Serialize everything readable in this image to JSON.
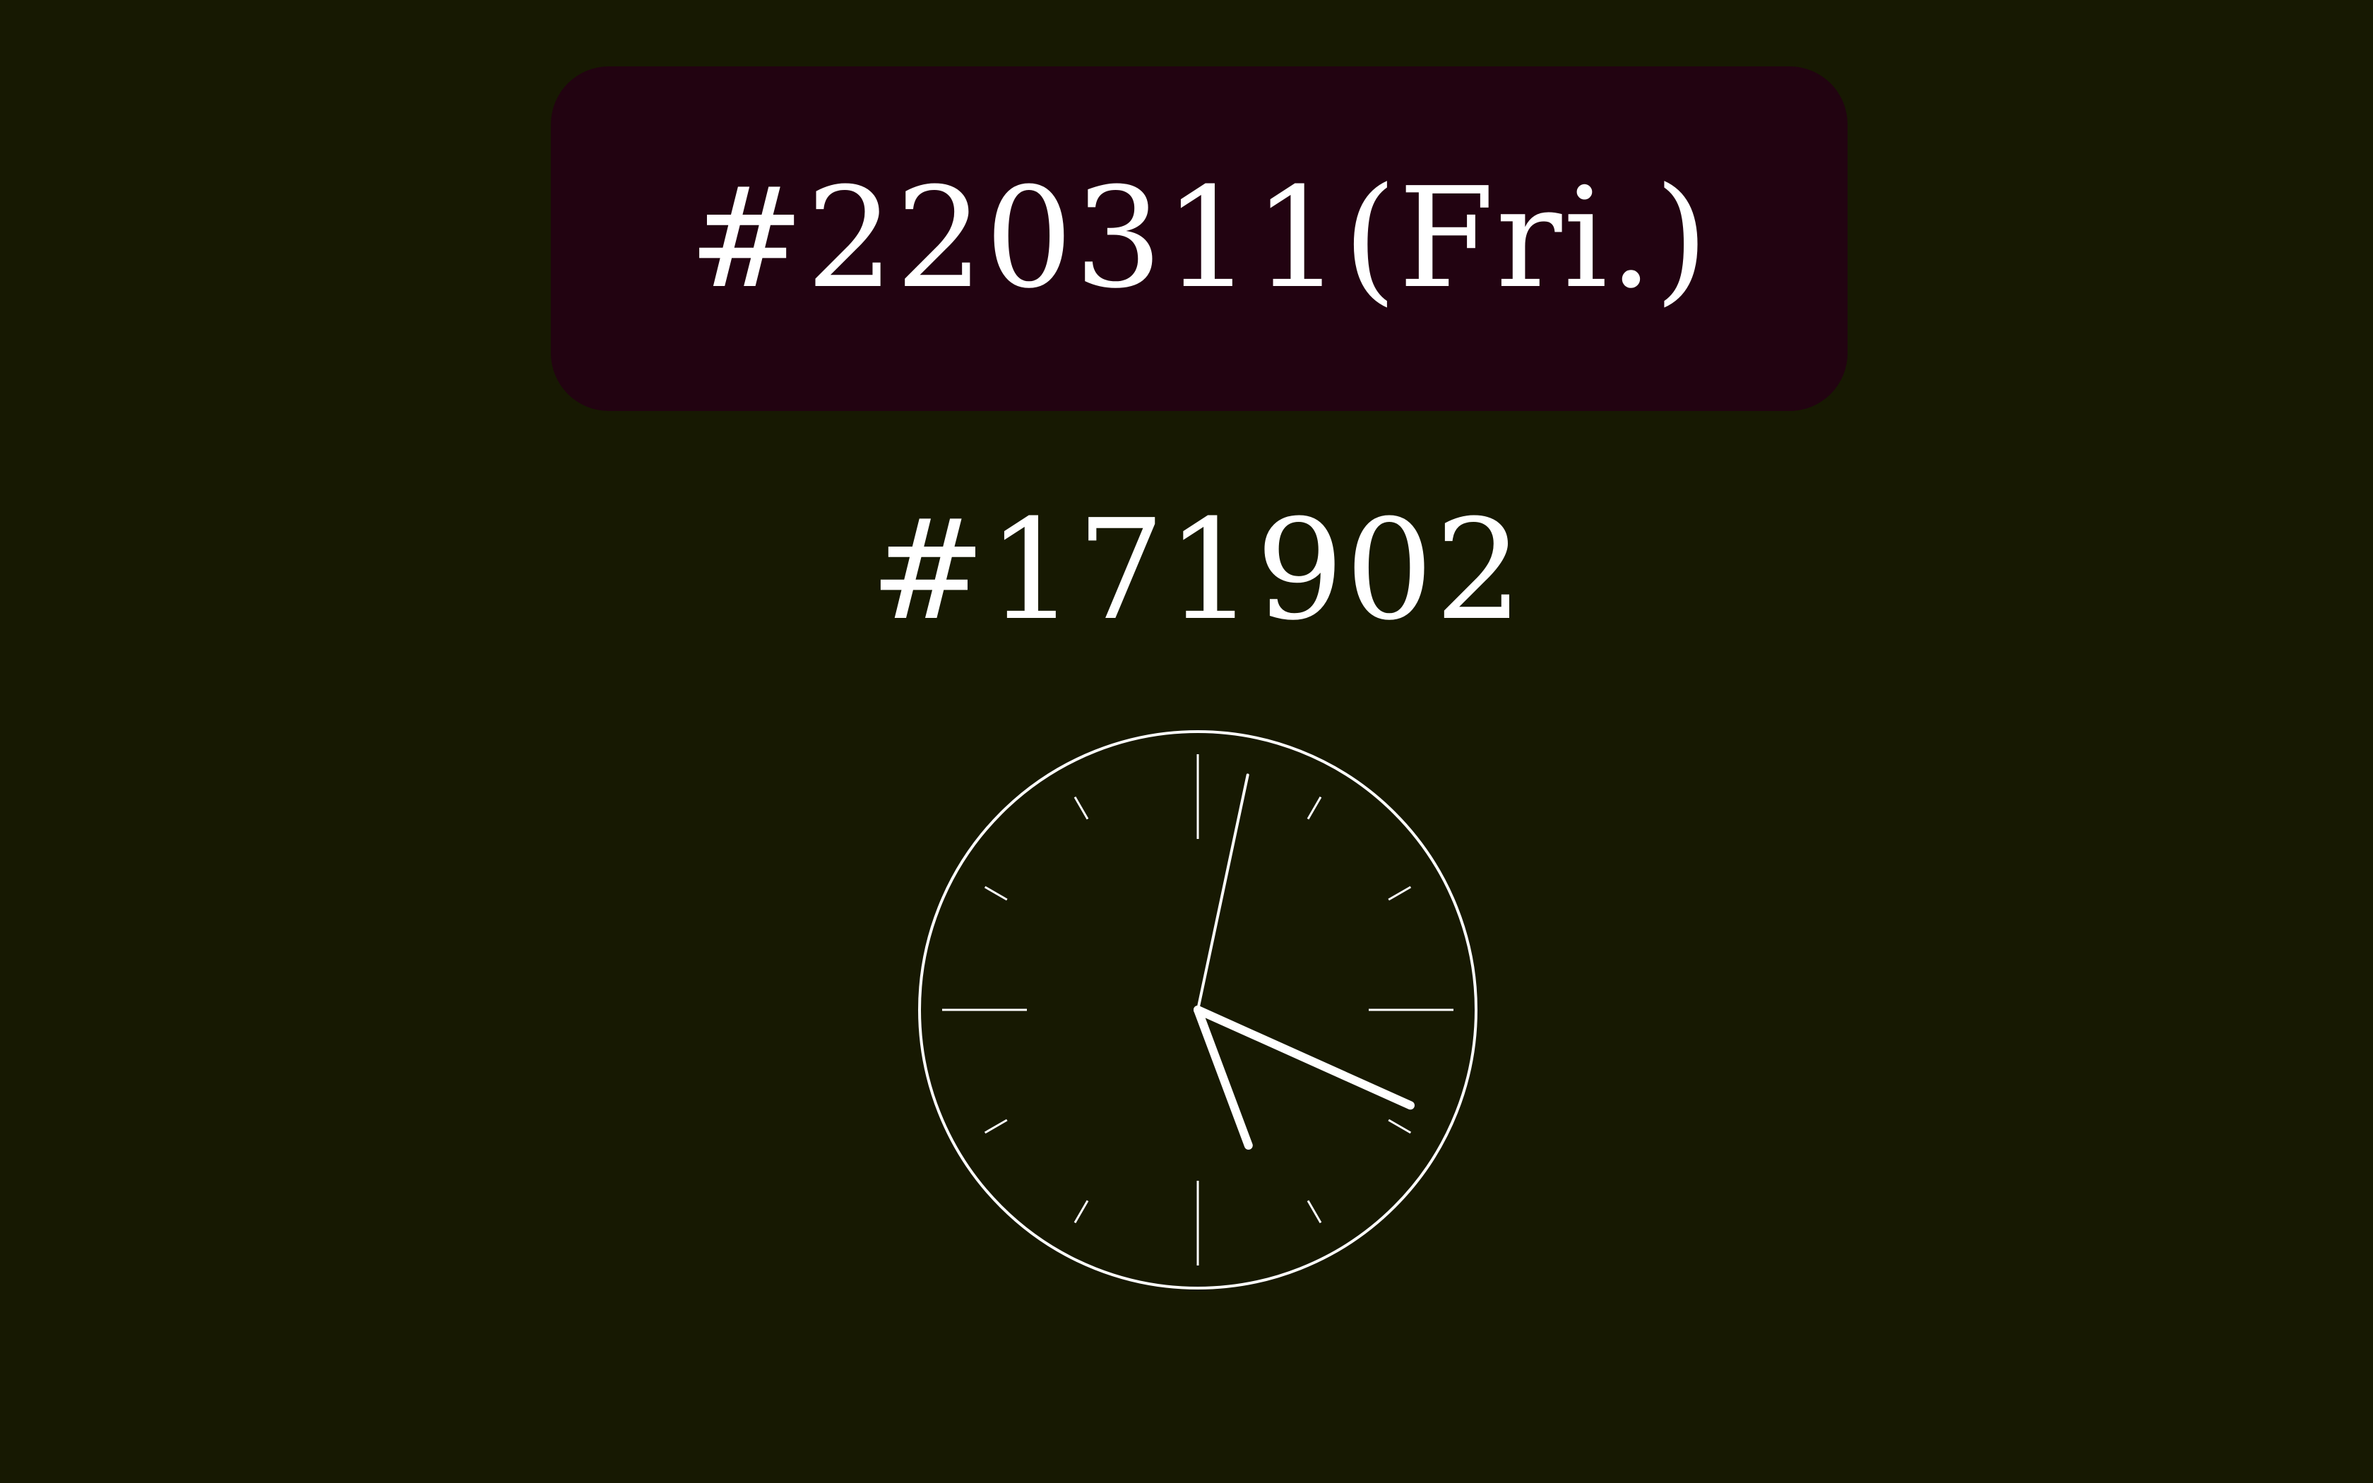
{
  "date_label": "#220311(Fri.)",
  "time_label": "#171902",
  "colors": {
    "background": "#171902",
    "panel": "#220311",
    "foreground": "#ffffff"
  },
  "clock": {
    "hours": 17,
    "minutes": 19,
    "seconds": 2
  }
}
